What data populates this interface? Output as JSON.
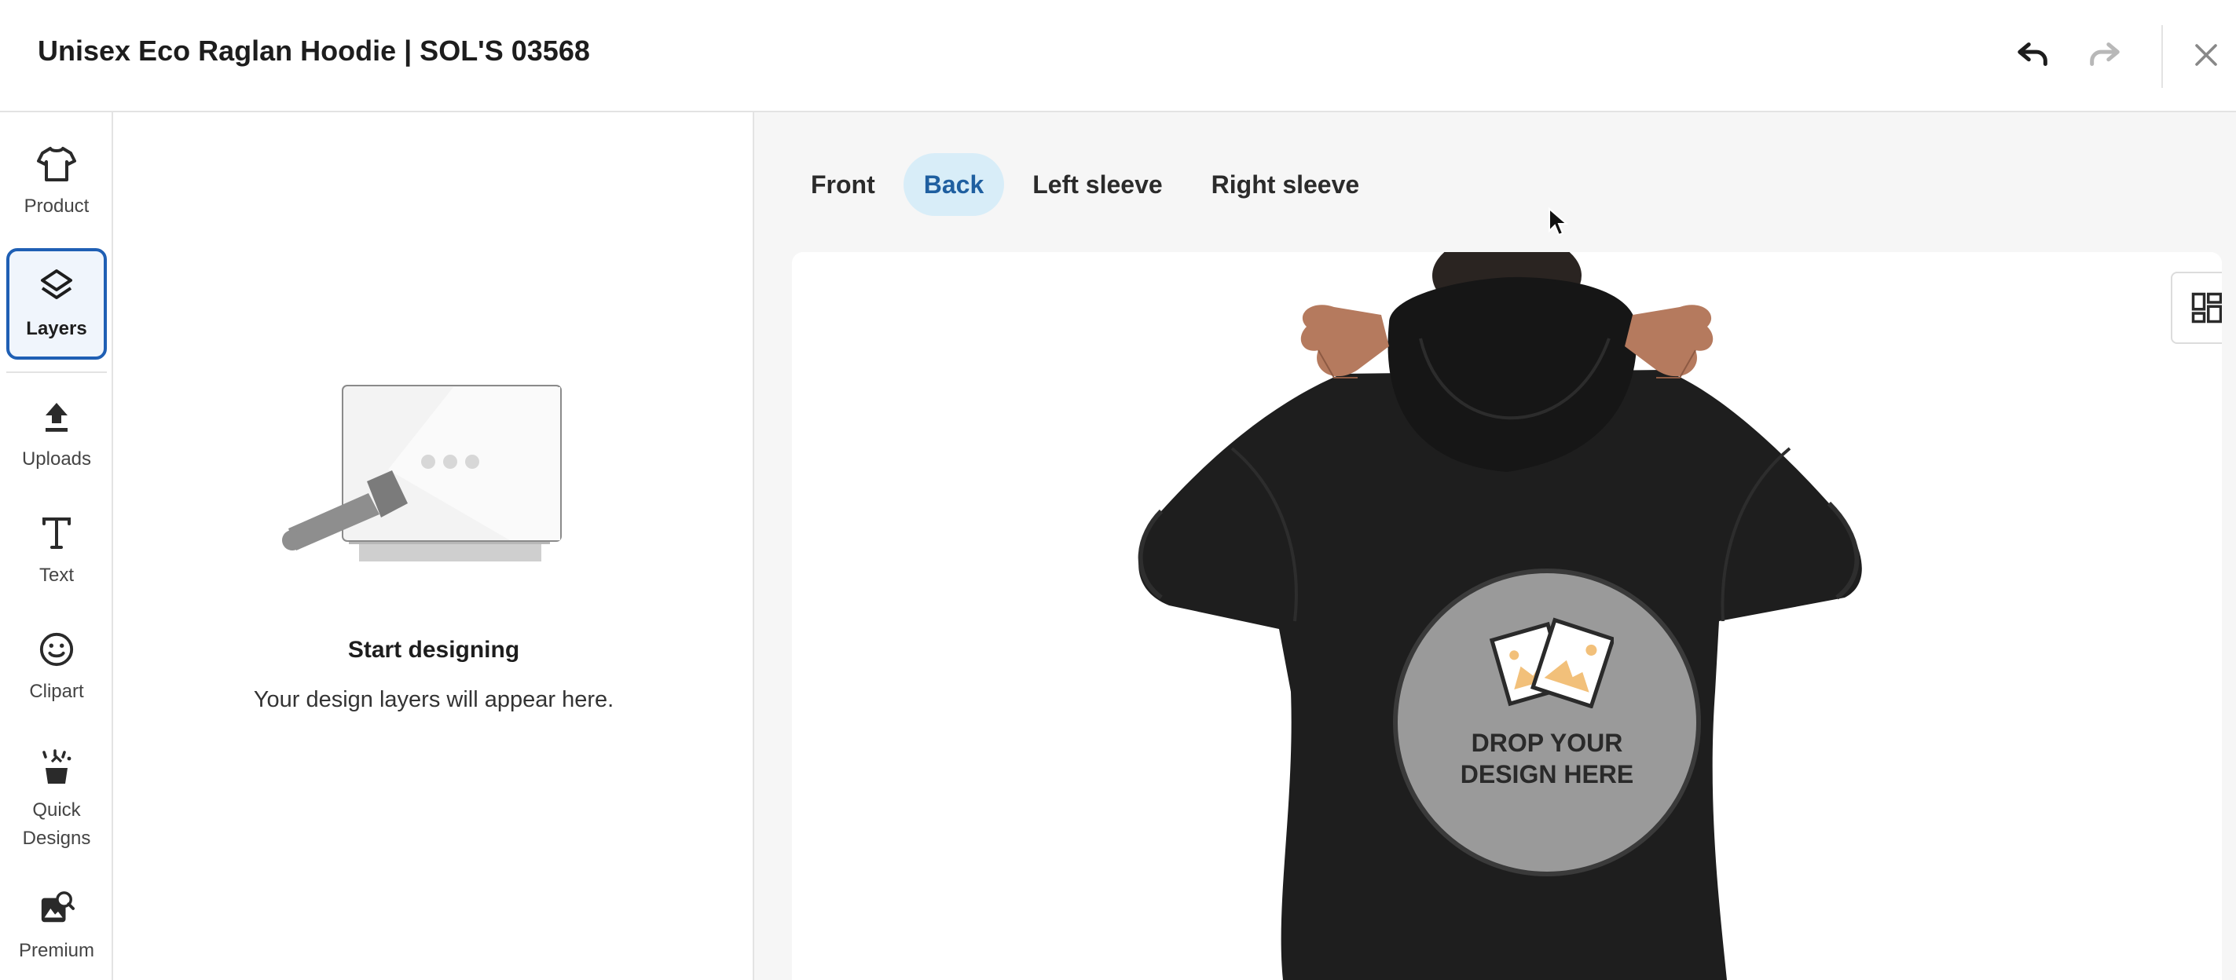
{
  "header": {
    "title": "Unisex Eco Raglan Hoodie | SOL'S 03568",
    "undo_icon": "undo-icon",
    "redo_icon": "redo-icon",
    "close_icon": "close-icon"
  },
  "rail": {
    "items": [
      {
        "label": "Product",
        "icon": "tshirt-icon"
      },
      {
        "label": "Layers",
        "icon": "layers-icon",
        "active": true
      },
      {
        "label": "Uploads",
        "icon": "upload-icon"
      },
      {
        "label": "Text",
        "icon": "text-icon"
      },
      {
        "label": "Clipart",
        "icon": "smiley-icon"
      },
      {
        "label": "Quick Designs",
        "icon": "magic-wand-icon"
      },
      {
        "label": "Premium",
        "icon": "premium-image-icon"
      }
    ]
  },
  "layers_panel": {
    "empty_title": "Start designing",
    "empty_subtitle": "Your design layers will appear here."
  },
  "canvas": {
    "tabs": [
      {
        "label": "Front",
        "active": false
      },
      {
        "label": "Back",
        "active": true
      },
      {
        "label": "Left sleeve",
        "active": false
      },
      {
        "label": "Right sleeve",
        "active": false
      }
    ],
    "drop_zone_text": "DROP YOUR DESIGN HERE",
    "layout_icon": "grid-layout-icon"
  },
  "colors": {
    "accent": "#1f5fb4",
    "active_tab_bg": "#d8edf8",
    "hoodie": "#1e1e1e",
    "drop_zone": "#9a9a9a"
  }
}
